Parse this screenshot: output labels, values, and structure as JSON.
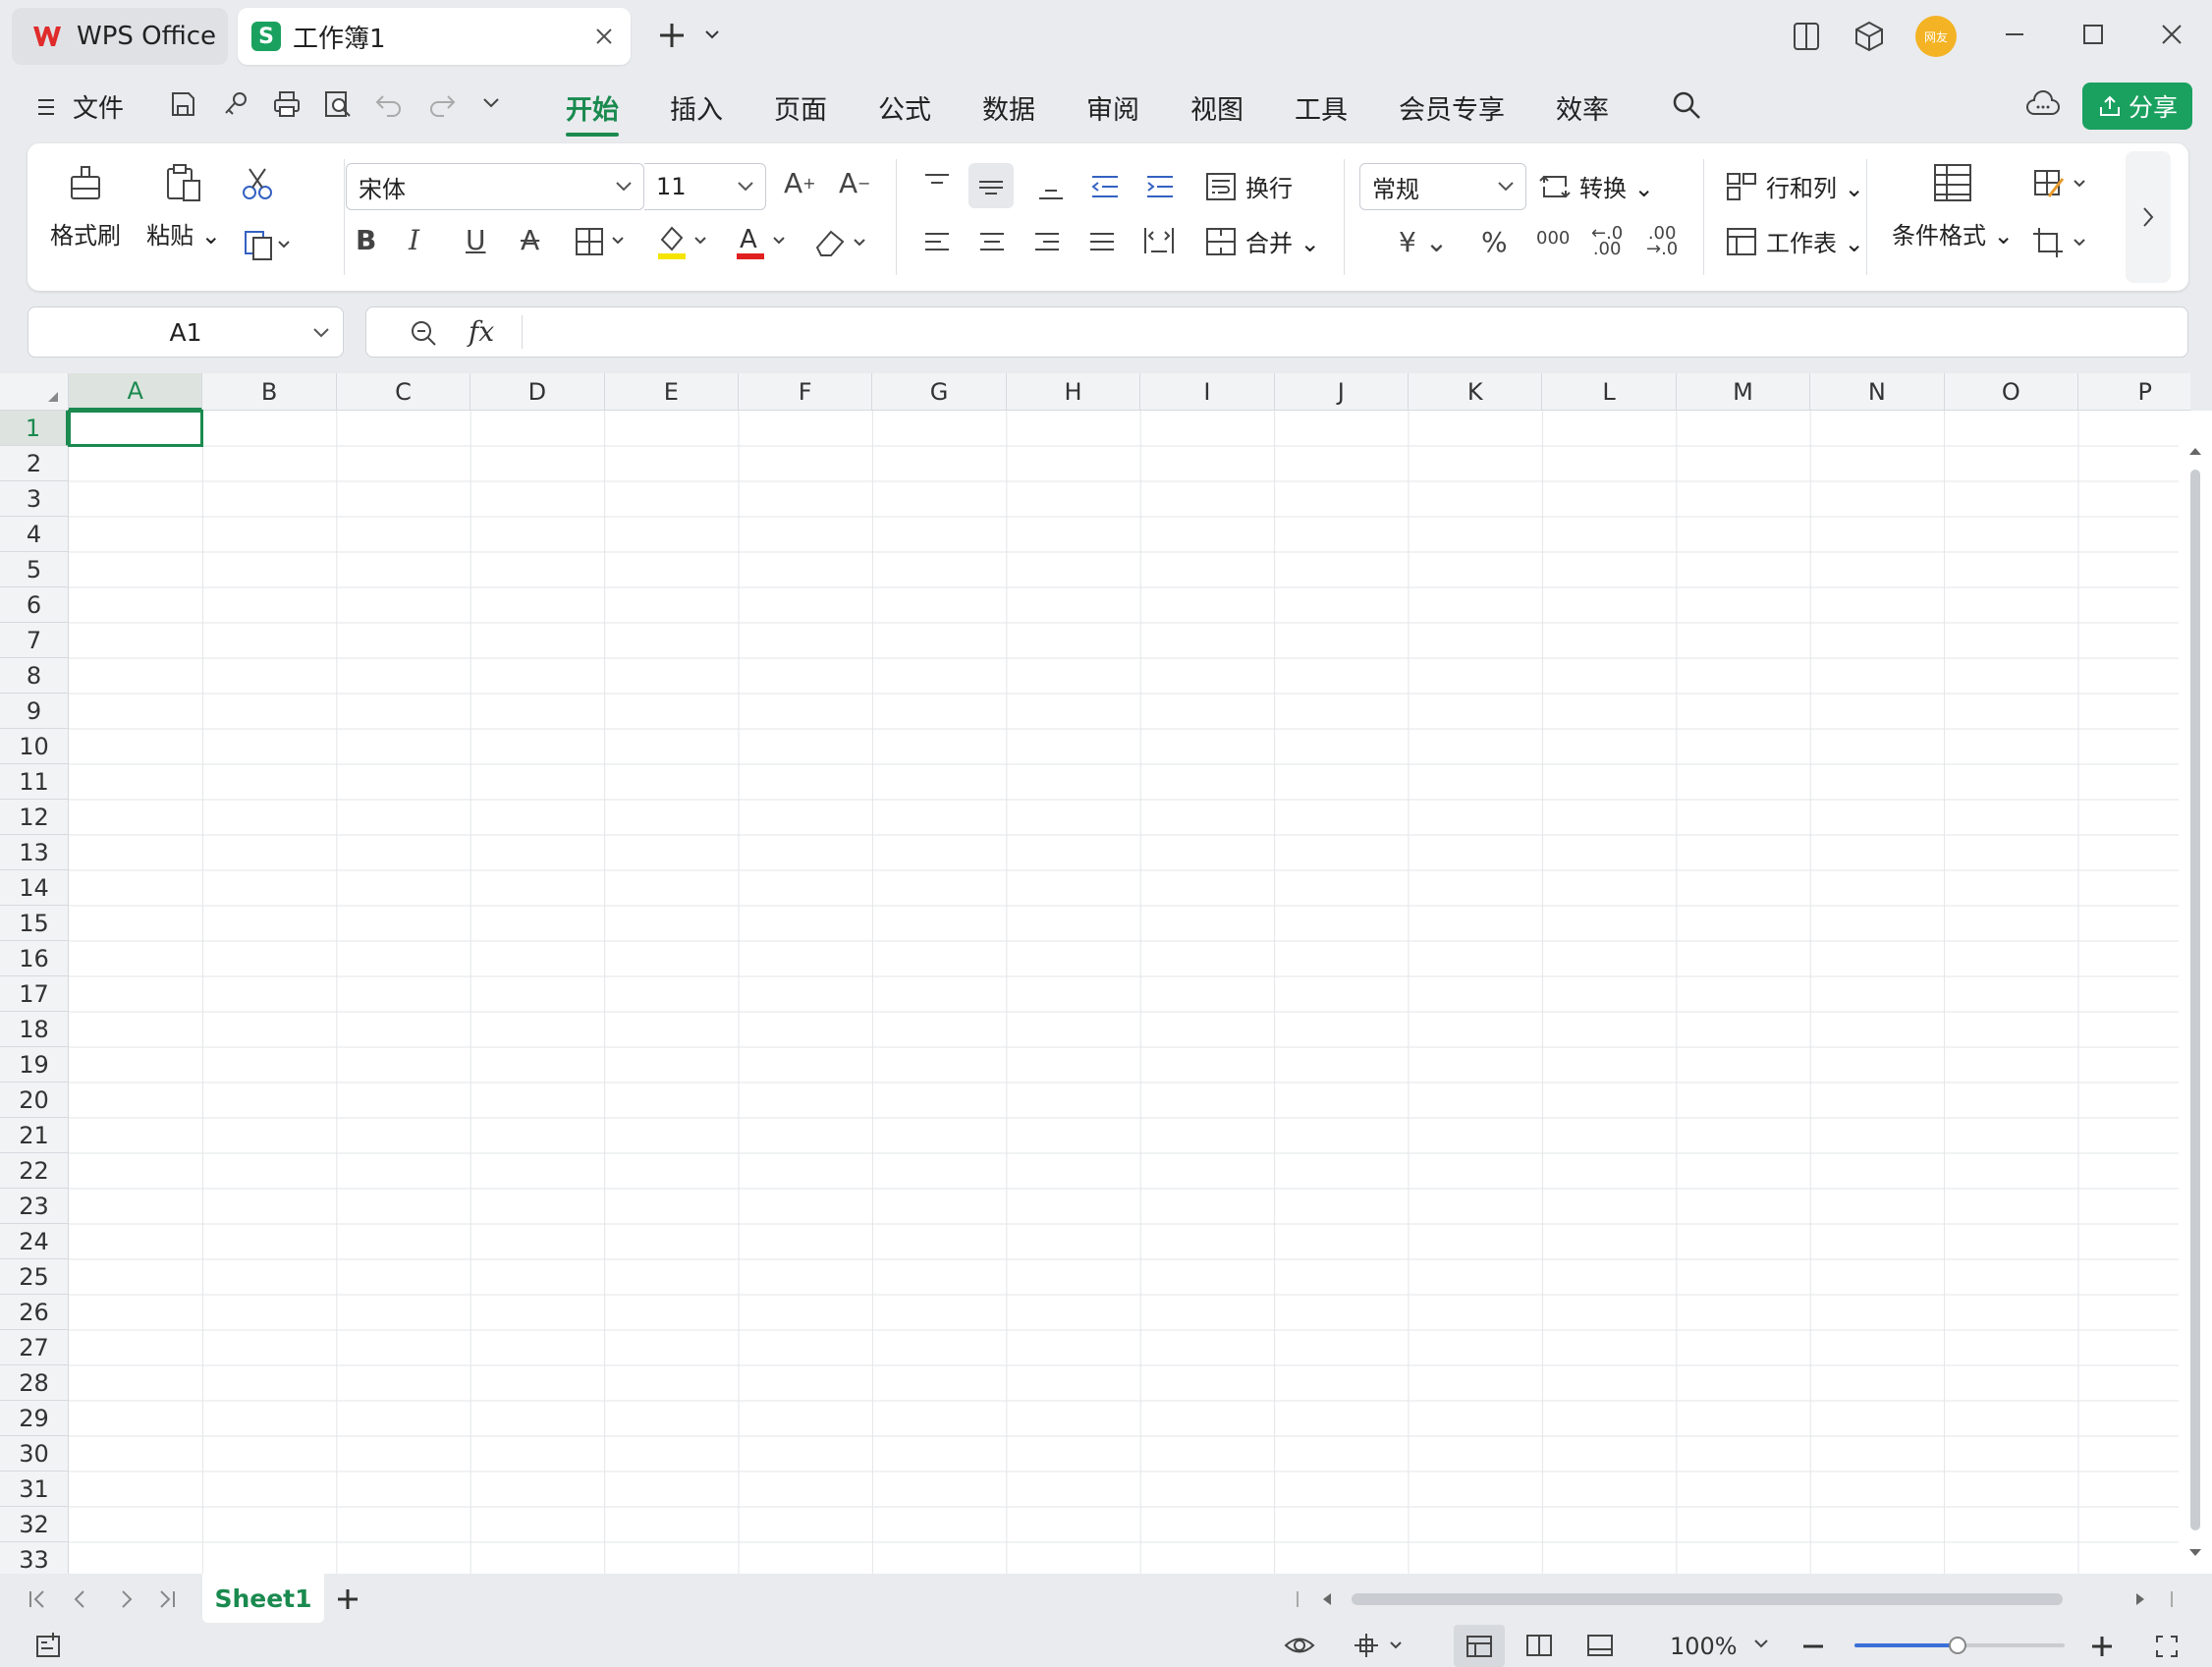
{
  "titlebar": {
    "app_tab": "WPS Office",
    "doc_tab": "工作簿1",
    "doc_badge": "S",
    "avatar_text": "网友"
  },
  "menubar": {
    "file": "文件",
    "tabs": [
      "开始",
      "插入",
      "页面",
      "公式",
      "数据",
      "审阅",
      "视图",
      "工具",
      "会员专享",
      "效率"
    ],
    "active_tab": "开始",
    "share": "分享"
  },
  "ribbon": {
    "format_painter": "格式刷",
    "paste": "粘贴",
    "font_name": "宋体",
    "font_size": "11",
    "wrap": "换行",
    "merge": "合并",
    "number_format": "常规",
    "convert": "转换",
    "row_col": "行和列",
    "worksheet": "工作表",
    "cond_format": "条件格式"
  },
  "formula": {
    "name_box": "A1",
    "fx": "fx",
    "value": ""
  },
  "grid": {
    "columns": [
      "A",
      "B",
      "C",
      "D",
      "E",
      "F",
      "G",
      "H",
      "I",
      "J",
      "K",
      "L",
      "M",
      "N",
      "O",
      "P"
    ],
    "rows": [
      "1",
      "2",
      "3",
      "4",
      "5",
      "6",
      "7",
      "8",
      "9",
      "10",
      "11",
      "12",
      "13",
      "14",
      "15",
      "16",
      "17",
      "18",
      "19",
      "20",
      "21",
      "22",
      "23",
      "24",
      "25",
      "26",
      "27",
      "28",
      "29",
      "30",
      "31",
      "32",
      "33"
    ],
    "selected_cell": "A1"
  },
  "sheets": {
    "tabs": [
      "Sheet1"
    ],
    "active": "Sheet1"
  },
  "status": {
    "zoom": "100%"
  },
  "colors": {
    "accent": "#1a8a4f",
    "share_bg": "#1aa15f",
    "fill_swatch": "#f5e400",
    "font_color_swatch": "#e02020"
  }
}
